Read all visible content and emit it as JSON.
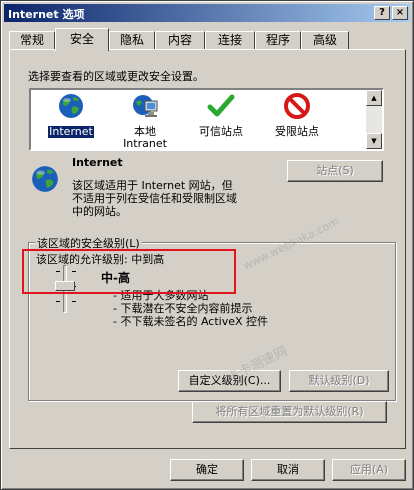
{
  "window": {
    "title": "Internet 选项",
    "help_glyph": "?",
    "close_glyph": "×"
  },
  "tabs": [
    {
      "label": "常规"
    },
    {
      "label": "安全"
    },
    {
      "label": "隐私"
    },
    {
      "label": "内容"
    },
    {
      "label": "连接"
    },
    {
      "label": "程序"
    },
    {
      "label": "高级"
    }
  ],
  "security": {
    "instruction": "选择要查看的区域或更改安全设置。",
    "zones": [
      {
        "line1": "Internet",
        "line2": "",
        "icon": "globe-icon"
      },
      {
        "line1": "本地",
        "line2": "Intranet",
        "icon": "intranet-computer-icon"
      },
      {
        "line1": "可信站点",
        "line2": "",
        "icon": "checkmark-icon"
      },
      {
        "line1": "受限站点",
        "line2": "",
        "icon": "restricted-icon"
      }
    ],
    "scroll_up": "▲",
    "scroll_down": "▼",
    "zone_info": {
      "name": "Internet",
      "desc1": "该区域适用于 Internet 网站，但",
      "desc2": "不适用于列在受信任和受限制区域",
      "desc3": "中的网站。"
    },
    "sites_button": "站点(S)",
    "group_title": "该区域的安全级别(L)",
    "allowed_levels": "该区域的允许级别: 中到高",
    "level_name": "中-高",
    "level_bullets": [
      "- 适用于大多数网站",
      "- 下载潜在不安全内容前提示",
      "- 不下载未签名的 ActiveX 控件"
    ],
    "custom_level_button": "自定义级别(C)...",
    "default_level_button": "默认级别(D)",
    "reset_all_button": "将所有区域重置为默认级别(R)"
  },
  "footer": {
    "ok": "确定",
    "cancel": "取消",
    "apply": "应用(A)"
  },
  "watermarks": {
    "site": "www.webkaka.com",
    "cn": "卡卡测速网"
  },
  "colors": {
    "title_start": "#0a246a",
    "title_end": "#a6caf0",
    "face": "#d4d0c8",
    "highlight_box": "#e0141e",
    "selection": "#0a246a"
  }
}
